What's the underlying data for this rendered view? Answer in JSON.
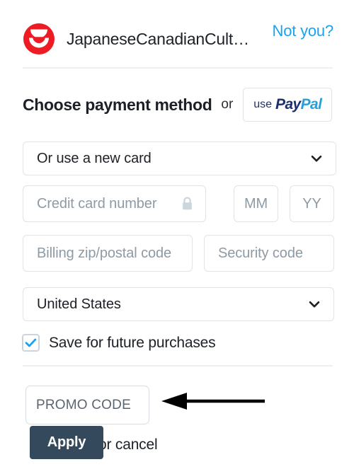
{
  "header": {
    "logo_icon": "jccc-circle-logo-icon",
    "account_name": "JapaneseCanadianCult…",
    "not_you_label": "Not you?",
    "not_you_color": "#19a2f0"
  },
  "payment": {
    "section_title": "Choose payment method",
    "or_label": "or",
    "paypal": {
      "use_label": "use",
      "pay_label": "Pay",
      "pal_label": "Pal",
      "pay_color": "#1b2e6e",
      "pal_color": "#26a0da"
    },
    "saved_card_select": {
      "value": "Or use a new card",
      "chevron_icon": "chevron-down-icon"
    },
    "card_number": {
      "placeholder": "Credit card number",
      "lock_icon": "lock-icon"
    },
    "exp_month": {
      "placeholder": "MM"
    },
    "exp_year": {
      "placeholder": "YY"
    },
    "billing_zip": {
      "placeholder": "Billing zip/postal code"
    },
    "security_code": {
      "placeholder": "Security code"
    },
    "country_select": {
      "value": "United States",
      "chevron_icon": "chevron-down-icon"
    },
    "save_checkbox": {
      "label": "Save for future purchases",
      "checked": true,
      "check_color": "#19a2f0"
    }
  },
  "promo": {
    "input_placeholder": "PROMO CODE",
    "apply_label": "Apply",
    "apply_bg": "#34495c",
    "or_label": "or",
    "cancel_label": "cancel",
    "annotation_arrow": "left-arrow-annotation-icon"
  }
}
